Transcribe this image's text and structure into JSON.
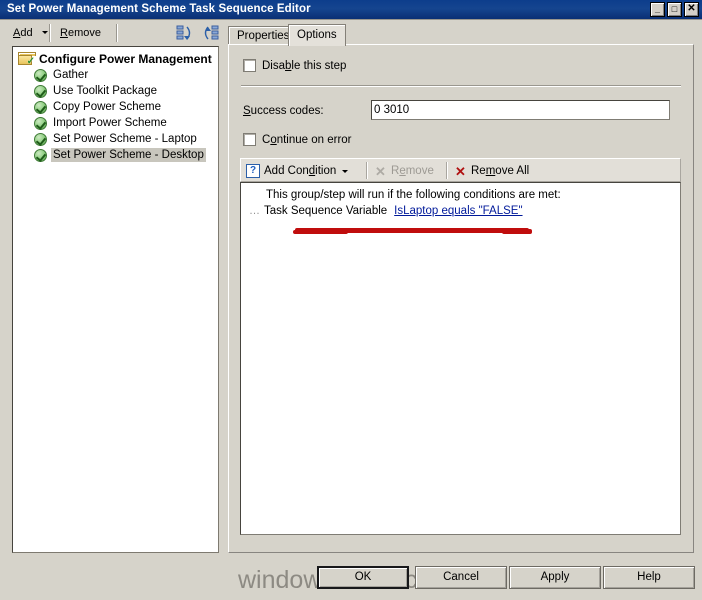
{
  "window": {
    "title": "Set Power Management Scheme Task Sequence Editor",
    "minimize_label": "_",
    "maximize_label": "□",
    "close_label": "✕"
  },
  "toolbar": {
    "add_label": "Add",
    "remove_label": "Remove",
    "icon1_name": "move-down-tree-icon",
    "icon2_name": "move-up-tree-icon"
  },
  "tree": {
    "items": [
      {
        "label": "Configure Power Management",
        "icon": "folder-checked-icon",
        "level": 0,
        "selected": false
      },
      {
        "label": "Gather",
        "icon": "green-check-icon",
        "level": 1,
        "selected": false
      },
      {
        "label": "Use Toolkit Package",
        "icon": "green-check-icon",
        "level": 1,
        "selected": false
      },
      {
        "label": "Copy Power Scheme",
        "icon": "green-check-icon",
        "level": 1,
        "selected": false
      },
      {
        "label": "Import Power Scheme",
        "icon": "green-check-icon",
        "level": 1,
        "selected": false
      },
      {
        "label": "Set Power Scheme - Laptop",
        "icon": "green-check-icon",
        "level": 1,
        "selected": false
      },
      {
        "label": "Set Power Scheme - Desktop",
        "icon": "green-check-icon",
        "level": 1,
        "selected": true
      }
    ]
  },
  "tabs": [
    {
      "label": "Properties",
      "active": false
    },
    {
      "label": "Options",
      "active": true
    }
  ],
  "options": {
    "disable_step_label": "Disable this step",
    "disable_step_checked": false,
    "success_codes_label": "Success codes:",
    "success_codes_value": "0 3010",
    "continue_on_error_label": "Continue on error",
    "continue_on_error_checked": false,
    "condition_toolbar": {
      "add_condition_label": "Add Condition",
      "remove_label": "Remove",
      "remove_disabled": true,
      "remove_all_label": "Remove All"
    },
    "condition_list": {
      "header": "This group/step will run if the following conditions are met:",
      "rows": [
        {
          "type": "Task Sequence Variable",
          "expression": "IsLaptop equals \"FALSE\""
        }
      ]
    }
  },
  "buttons": {
    "ok": "OK",
    "cancel": "Cancel",
    "apply": "Apply",
    "help": "Help"
  },
  "watermark": "windows-noob.com",
  "colors": {
    "titlebar": "#0c3d8c",
    "window_face": "#d6d3ca",
    "link": "#00199a",
    "annotation_red": "#c00d0d",
    "check_green": "#4f9a43"
  }
}
